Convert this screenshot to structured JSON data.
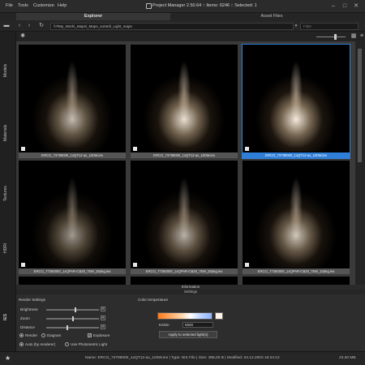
{
  "window": {
    "title": "Project Manager 2.50.64 :: Items: 6246 :: Selected: 1",
    "menu": [
      "File",
      "Tools",
      "Customize",
      "Help"
    ]
  },
  "tabs": {
    "explorer": "Explorer",
    "asset_files": "Asset Files"
  },
  "toolbar": {
    "path": "\\\\?\\My_Work\\_Maps\\_Maps_sorted\\_Light_maps",
    "filter_placeholder": "Filter"
  },
  "left_tabs": [
    "Models",
    "Materials",
    "Textures",
    "HDRI"
  ],
  "ies_tab": "IES",
  "thumbnails": [
    {
      "caption": "ERCO_73799000_1xQT12-ax_100W.ies",
      "selected": false,
      "brightness": 0.75
    },
    {
      "caption": "ERCO_73799000_1xQT12-ax_100W.ies",
      "selected": false,
      "brightness": 0.9
    },
    {
      "caption": "ERCO_73799000_1xQT12-ax_100W.ies",
      "selected": true,
      "brightness": 0.95
    },
    {
      "caption": "ERCO_77360000_1xQPAR-CB20_75W_25deg.ies",
      "selected": false,
      "brightness": 0.6
    },
    {
      "caption": "ERCO_77360000_1xQPAR-CB20_75W_25deg.ies",
      "selected": false,
      "brightness": 0.7
    },
    {
      "caption": "ERCO_77360000_1xQPAR-CB20_75W_10deg.ies",
      "selected": false,
      "brightness": 0.8
    }
  ],
  "panels": {
    "information": "Information",
    "settings": "Settings"
  },
  "render_settings": {
    "title": "Render Settings",
    "brightness_label": "Brightness",
    "zoom_label": "Zoom",
    "distance_label": "Distance",
    "brightness": 0.55,
    "zoom": 0.5,
    "distance": 0.4,
    "reset_label": "R",
    "mode_render": "Render",
    "mode_diagram": "Diagram",
    "explosure_label": "Explosure",
    "auto_label": "Auto (by renderer)",
    "photometric_label": "Use Photometric Light"
  },
  "color_temperature": {
    "title": "Color temperature",
    "kelvin_label": "Kelvin",
    "kelvin_value": "6500",
    "apply_label": "Apply to selected light(s)"
  },
  "status": {
    "text": "Name: ERCO_73799000_1xQT12-ax_100W.ies | Type: IES File | Size: 386,00 B | Modified: 04.12.2003 16:24:12",
    "memory": "23,30 MB"
  },
  "colors": {
    "accent": "#2f7fd8",
    "background": "#1e1e1e"
  }
}
